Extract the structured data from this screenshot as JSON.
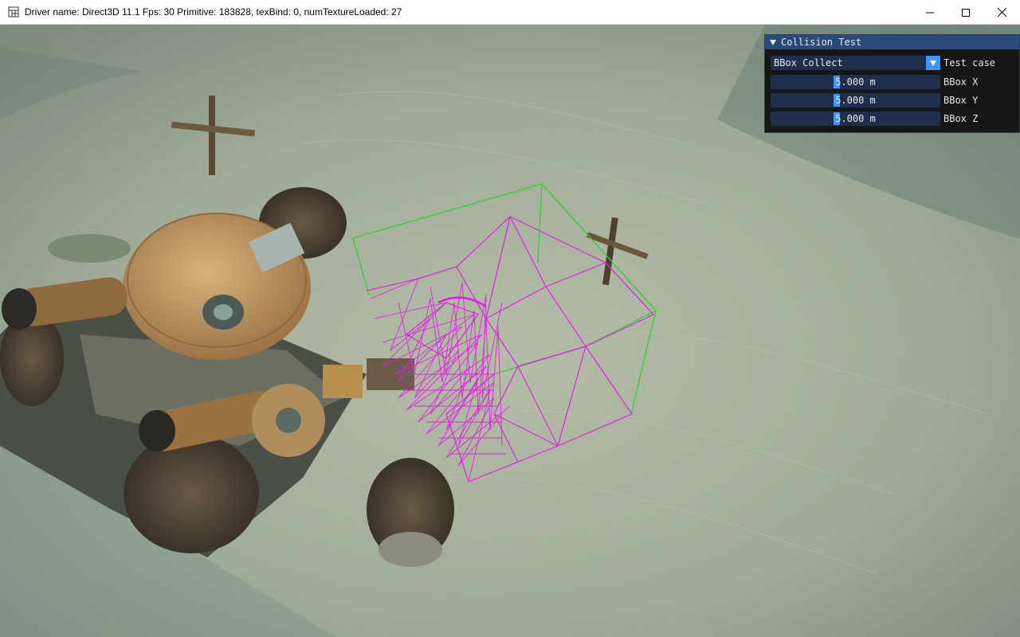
{
  "window": {
    "title": "Driver name: Direct3D 11.1 Fps: 30 Primitive: 183828, texBind: 0, numTextureLoaded: 27",
    "icon": "app-grid-icon",
    "controls": [
      "minimize-icon",
      "maximize-icon",
      "close-icon"
    ]
  },
  "panel": {
    "title": "Collision Test",
    "test_case": {
      "value": "BBox Collect",
      "label": "Test case"
    },
    "bbox_x": {
      "value": "5.000 m",
      "label": "BBox X"
    },
    "bbox_y": {
      "value": "5.000 m",
      "label": "BBox Y"
    },
    "bbox_z": {
      "value": "5.000 m",
      "label": "BBox Z"
    }
  },
  "colors": {
    "panel_header": "#294a7a",
    "widget_bg": "#1d2f4d",
    "accent": "#4296fa",
    "wireframe_mesh": "#e020e0",
    "bbox_outline": "#2fcf2f",
    "terrain": "#9aa896"
  }
}
